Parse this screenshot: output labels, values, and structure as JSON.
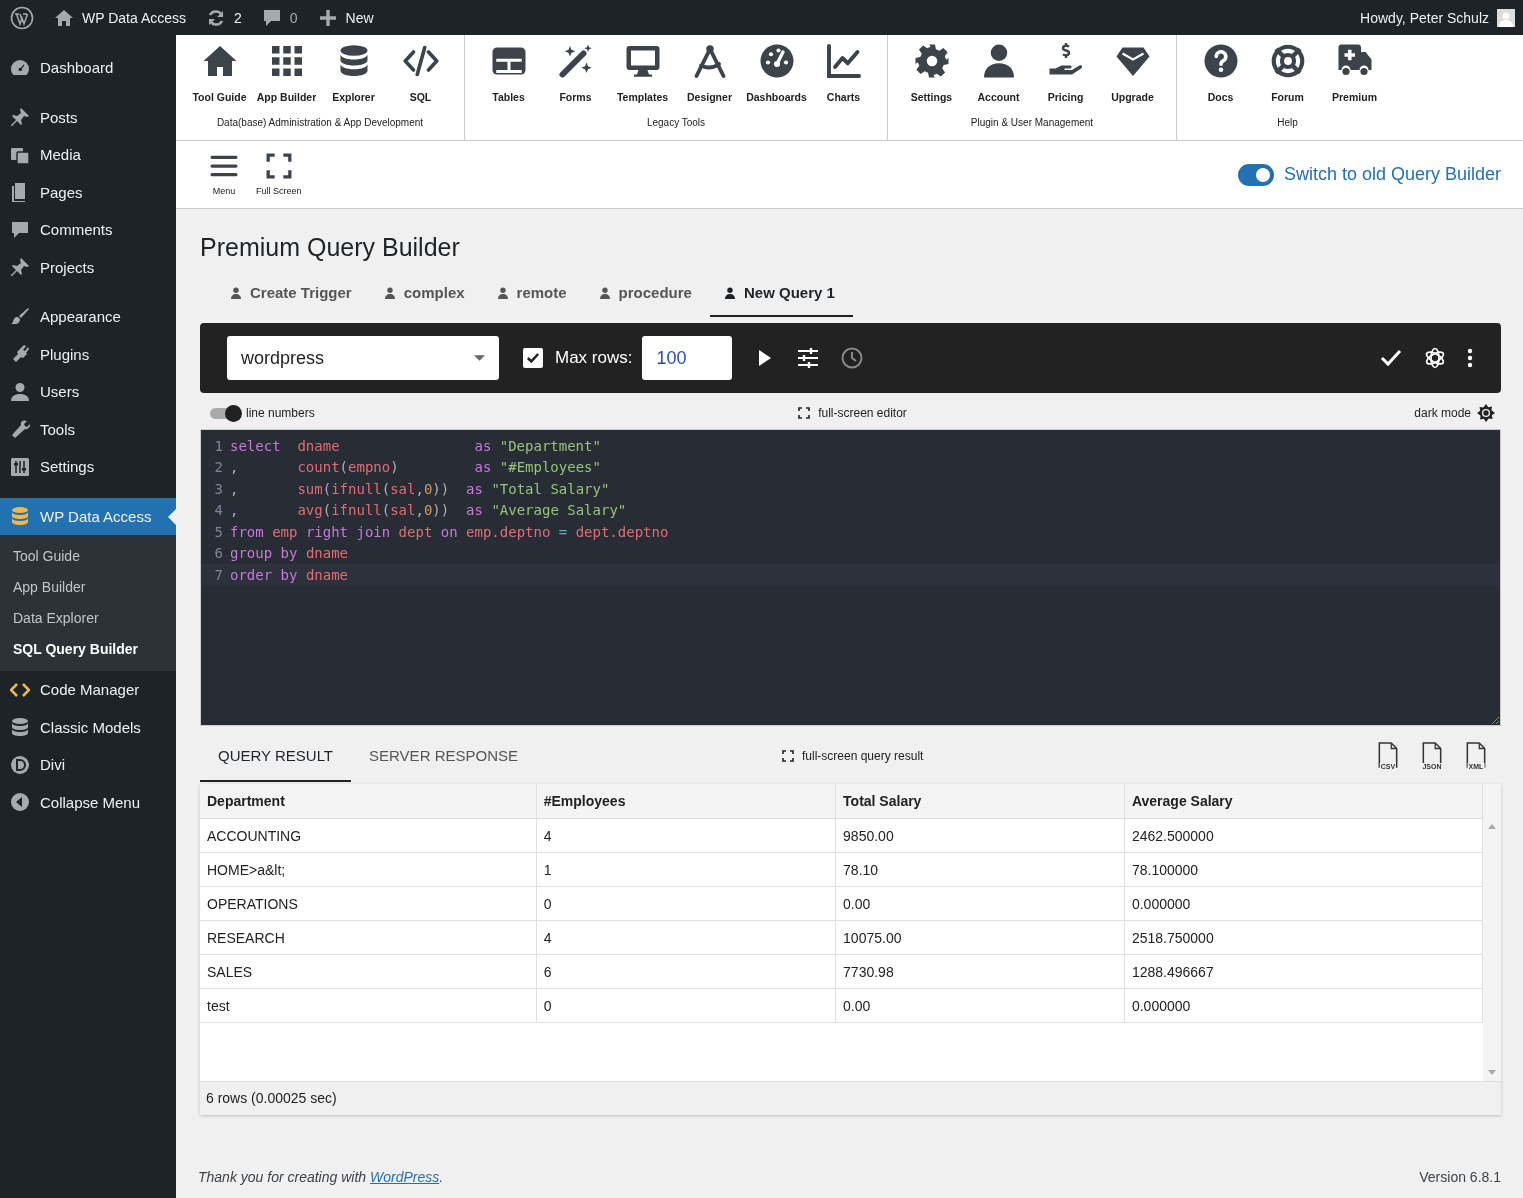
{
  "admin_bar": {
    "site": "WP Data Access",
    "updates": "2",
    "comments": "0",
    "new": "New",
    "greeting": "Howdy, Peter Schulz"
  },
  "sidebar": {
    "groups": [
      [
        {
          "label": "Dashboard",
          "selected": false
        }
      ],
      [
        {
          "label": "Posts",
          "selected": false
        },
        {
          "label": "Media",
          "selected": false
        },
        {
          "label": "Pages",
          "selected": false
        },
        {
          "label": "Comments",
          "selected": false
        },
        {
          "label": "Projects",
          "selected": false
        }
      ],
      [
        {
          "label": "Appearance",
          "selected": false
        },
        {
          "label": "Plugins",
          "selected": false
        },
        {
          "label": "Users",
          "selected": false
        },
        {
          "label": "Tools",
          "selected": false
        },
        {
          "label": "Settings",
          "selected": false
        }
      ],
      [
        {
          "label": "WP Data Access",
          "selected": true,
          "children": [
            {
              "label": "Tool Guide",
              "selected": false
            },
            {
              "label": "App Builder",
              "selected": false
            },
            {
              "label": "Data Explorer",
              "selected": false
            },
            {
              "label": "SQL Query Builder",
              "selected": true
            }
          ]
        },
        {
          "label": "Code Manager",
          "selected": false
        },
        {
          "label": "Classic Models",
          "selected": false
        },
        {
          "label": "Divi",
          "selected": false
        },
        {
          "label": "Collapse Menu",
          "selected": false
        }
      ]
    ]
  },
  "toolbar": {
    "groups": [
      {
        "label": "Data(base) Administration & App Development",
        "items": [
          "Tool Guide",
          "App Builder",
          "Explorer",
          "SQL"
        ]
      },
      {
        "label": "Legacy Tools",
        "items": [
          "Tables",
          "Forms",
          "Templates",
          "Designer",
          "Dashboards",
          "Charts"
        ]
      },
      {
        "label": "Plugin & User Management",
        "items": [
          "Settings",
          "Account",
          "Pricing",
          "Upgrade"
        ]
      },
      {
        "label": "Help",
        "items": [
          "Docs",
          "Forum",
          "Premium"
        ]
      }
    ]
  },
  "quick_actions": [
    "Menu",
    "Full Screen"
  ],
  "old_builder_switch": {
    "label": "Switch to old Query Builder",
    "on": true
  },
  "page_title": "Premium Query Builder",
  "query_tabs": [
    {
      "label": "Create Trigger",
      "selected": false
    },
    {
      "label": "complex",
      "selected": false
    },
    {
      "label": "remote",
      "selected": false
    },
    {
      "label": "procedure",
      "selected": false
    },
    {
      "label": "New Query 1",
      "selected": true
    }
  ],
  "query_toolbar": {
    "database": "wordpress",
    "max_rows": {
      "label": "Max rows:",
      "checked": true,
      "value": "100"
    }
  },
  "editor_options": {
    "line_numbers": {
      "label": "line numbers",
      "on": true
    },
    "full_screen": "full-screen editor",
    "dark_mode": "dark mode"
  },
  "code_lines": [
    {
      "number": "1",
      "active": false,
      "tokens": [
        {
          "kind": "keyword",
          "text": "select  "
        },
        {
          "kind": "identifier",
          "text": "dname                "
        },
        {
          "kind": "keyword",
          "text": "as "
        },
        {
          "kind": "string",
          "text": "\"Department\""
        }
      ]
    },
    {
      "number": "2",
      "active": false,
      "tokens": [
        {
          "kind": "punctuation",
          "text": ",       "
        },
        {
          "kind": "identifier",
          "text": "count"
        },
        {
          "kind": "punctuation",
          "text": "("
        },
        {
          "kind": "identifier",
          "text": "empno"
        },
        {
          "kind": "punctuation",
          "text": ")         "
        },
        {
          "kind": "keyword",
          "text": "as "
        },
        {
          "kind": "string",
          "text": "\"#Employees\""
        }
      ]
    },
    {
      "number": "3",
      "active": false,
      "tokens": [
        {
          "kind": "punctuation",
          "text": ",       "
        },
        {
          "kind": "identifier",
          "text": "sum"
        },
        {
          "kind": "punctuation",
          "text": "("
        },
        {
          "kind": "identifier",
          "text": "ifnull"
        },
        {
          "kind": "punctuation",
          "text": "("
        },
        {
          "kind": "identifier",
          "text": "sal"
        },
        {
          "kind": "punctuation",
          "text": ","
        },
        {
          "kind": "number",
          "text": "0"
        },
        {
          "kind": "punctuation",
          "text": "))  "
        },
        {
          "kind": "keyword",
          "text": "as "
        },
        {
          "kind": "string",
          "text": "\"Total Salary\""
        }
      ]
    },
    {
      "number": "4",
      "active": false,
      "tokens": [
        {
          "kind": "punctuation",
          "text": ",       "
        },
        {
          "kind": "identifier",
          "text": "avg"
        },
        {
          "kind": "punctuation",
          "text": "("
        },
        {
          "kind": "identifier",
          "text": "ifnull"
        },
        {
          "kind": "punctuation",
          "text": "("
        },
        {
          "kind": "identifier",
          "text": "sal"
        },
        {
          "kind": "punctuation",
          "text": ","
        },
        {
          "kind": "number",
          "text": "0"
        },
        {
          "kind": "punctuation",
          "text": "))  "
        },
        {
          "kind": "keyword",
          "text": "as "
        },
        {
          "kind": "string",
          "text": "\"Average Salary\""
        }
      ]
    },
    {
      "number": "5",
      "active": false,
      "tokens": [
        {
          "kind": "keyword",
          "text": "from "
        },
        {
          "kind": "identifier",
          "text": "emp "
        },
        {
          "kind": "keyword",
          "text": "right "
        },
        {
          "kind": "keyword",
          "text": "join "
        },
        {
          "kind": "identifier",
          "text": "dept "
        },
        {
          "kind": "keyword",
          "text": "on "
        },
        {
          "kind": "identifier",
          "text": "emp.deptno "
        },
        {
          "kind": "operator",
          "text": "= "
        },
        {
          "kind": "identifier",
          "text": "dept.deptno"
        }
      ]
    },
    {
      "number": "6",
      "active": false,
      "tokens": [
        {
          "kind": "keyword",
          "text": "group "
        },
        {
          "kind": "keyword",
          "text": "by "
        },
        {
          "kind": "identifier",
          "text": "dname"
        }
      ]
    },
    {
      "number": "7",
      "active": true,
      "tokens": [
        {
          "kind": "keyword",
          "text": "order "
        },
        {
          "kind": "keyword",
          "text": "by "
        },
        {
          "kind": "identifier",
          "text": "dname"
        }
      ]
    }
  ],
  "result_tabs": [
    {
      "label": "QUERY RESULT",
      "selected": true
    },
    {
      "label": "SERVER RESPONSE",
      "selected": false
    }
  ],
  "full_screen_result": "full-screen query result",
  "exports": [
    "CSV",
    "JSON",
    "XML"
  ],
  "table": {
    "columns": [
      "Department",
      "#Employees",
      "Total Salary",
      "Average Salary"
    ],
    "rows": [
      [
        "ACCOUNTING",
        "4",
        "9850.00",
        "2462.500000"
      ],
      [
        "HOME>a&lt;",
        "1",
        "78.10",
        "78.100000"
      ],
      [
        "OPERATIONS",
        "0",
        "0.00",
        "0.000000"
      ],
      [
        "RESEARCH",
        "4",
        "10075.00",
        "2518.750000"
      ],
      [
        "SALES",
        "6",
        "7730.98",
        "1288.496667"
      ],
      [
        "test",
        "0",
        "0.00",
        "0.000000"
      ]
    ]
  },
  "status": "6 rows (0.00025 sec)",
  "footer": {
    "text_before": "Thank you for creating with ",
    "link": "WordPress",
    "text_after": ".",
    "version": "Version 6.8.1"
  }
}
